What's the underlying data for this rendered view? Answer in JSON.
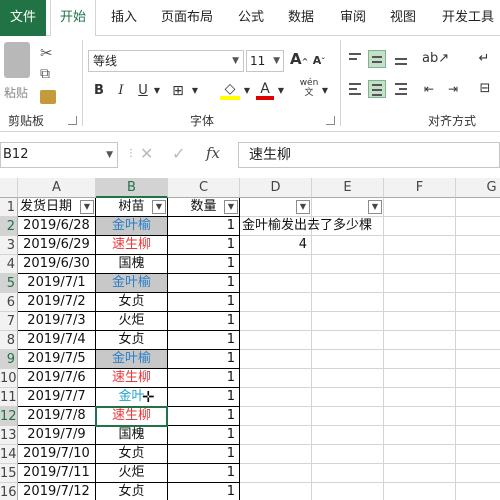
{
  "ribbon": {
    "tabs": [
      {
        "label": "文件"
      },
      {
        "label": "开始"
      },
      {
        "label": "插入"
      },
      {
        "label": "页面布局"
      },
      {
        "label": "公式"
      },
      {
        "label": "数据"
      },
      {
        "label": "审阅"
      },
      {
        "label": "视图"
      },
      {
        "label": "开发工具"
      }
    ],
    "clipboard": {
      "paste_label": "粘贴",
      "group_label": "剪贴板"
    },
    "font": {
      "name": "等线",
      "size": "11",
      "group_label": "字体",
      "phonetic_label": "wén"
    },
    "alignment": {
      "group_label": "对齐方式"
    }
  },
  "formula_bar": {
    "name_box": "B12",
    "cancel": "✕",
    "enter": "✓",
    "fx": "fx",
    "content": "速生柳"
  },
  "sheet": {
    "columns": [
      "A",
      "B",
      "C",
      "D",
      "E",
      "F",
      "G"
    ],
    "header_row": {
      "row": "1",
      "a": "发货日期",
      "b": "树苗",
      "c": "数量"
    },
    "rows": [
      {
        "row": "2",
        "date": "2019/6/28",
        "tree": "金叶榆",
        "qty": "1"
      },
      {
        "row": "3",
        "date": "2019/6/29",
        "tree": "速生柳",
        "qty": "1"
      },
      {
        "row": "4",
        "date": "2019/6/30",
        "tree": "国槐",
        "qty": "1"
      },
      {
        "row": "5",
        "date": "2019/7/1",
        "tree": "金叶榆",
        "qty": "1"
      },
      {
        "row": "6",
        "date": "2019/7/2",
        "tree": "女贞",
        "qty": "1"
      },
      {
        "row": "7",
        "date": "2019/7/3",
        "tree": "火炬",
        "qty": "1"
      },
      {
        "row": "8",
        "date": "2019/7/4",
        "tree": "女贞",
        "qty": "1"
      },
      {
        "row": "9",
        "date": "2019/7/5",
        "tree": "金叶榆",
        "qty": "1"
      },
      {
        "row": "10",
        "date": "2019/7/6",
        "tree": "速生柳",
        "qty": "1"
      },
      {
        "row": "11",
        "date": "2019/7/7",
        "tree": "金叶",
        "qty": "1"
      },
      {
        "row": "12",
        "date": "2019/7/8",
        "tree": "速生柳",
        "qty": "1"
      },
      {
        "row": "13",
        "date": "2019/7/9",
        "tree": "国槐",
        "qty": "1"
      },
      {
        "row": "14",
        "date": "2019/7/10",
        "tree": "女贞",
        "qty": "1"
      },
      {
        "row": "15",
        "date": "2019/7/11",
        "tree": "火炬",
        "qty": "1"
      },
      {
        "row": "16",
        "date": "2019/7/12",
        "tree": "女贞",
        "qty": "1"
      }
    ],
    "d2": "金叶榆发出去了多少棵",
    "d3": "4"
  },
  "colors": {
    "accent": "#217346",
    "blue_text": "#2a7fc9",
    "red_text": "#e83a3a",
    "highlight_fill": "#c8c8c8"
  }
}
